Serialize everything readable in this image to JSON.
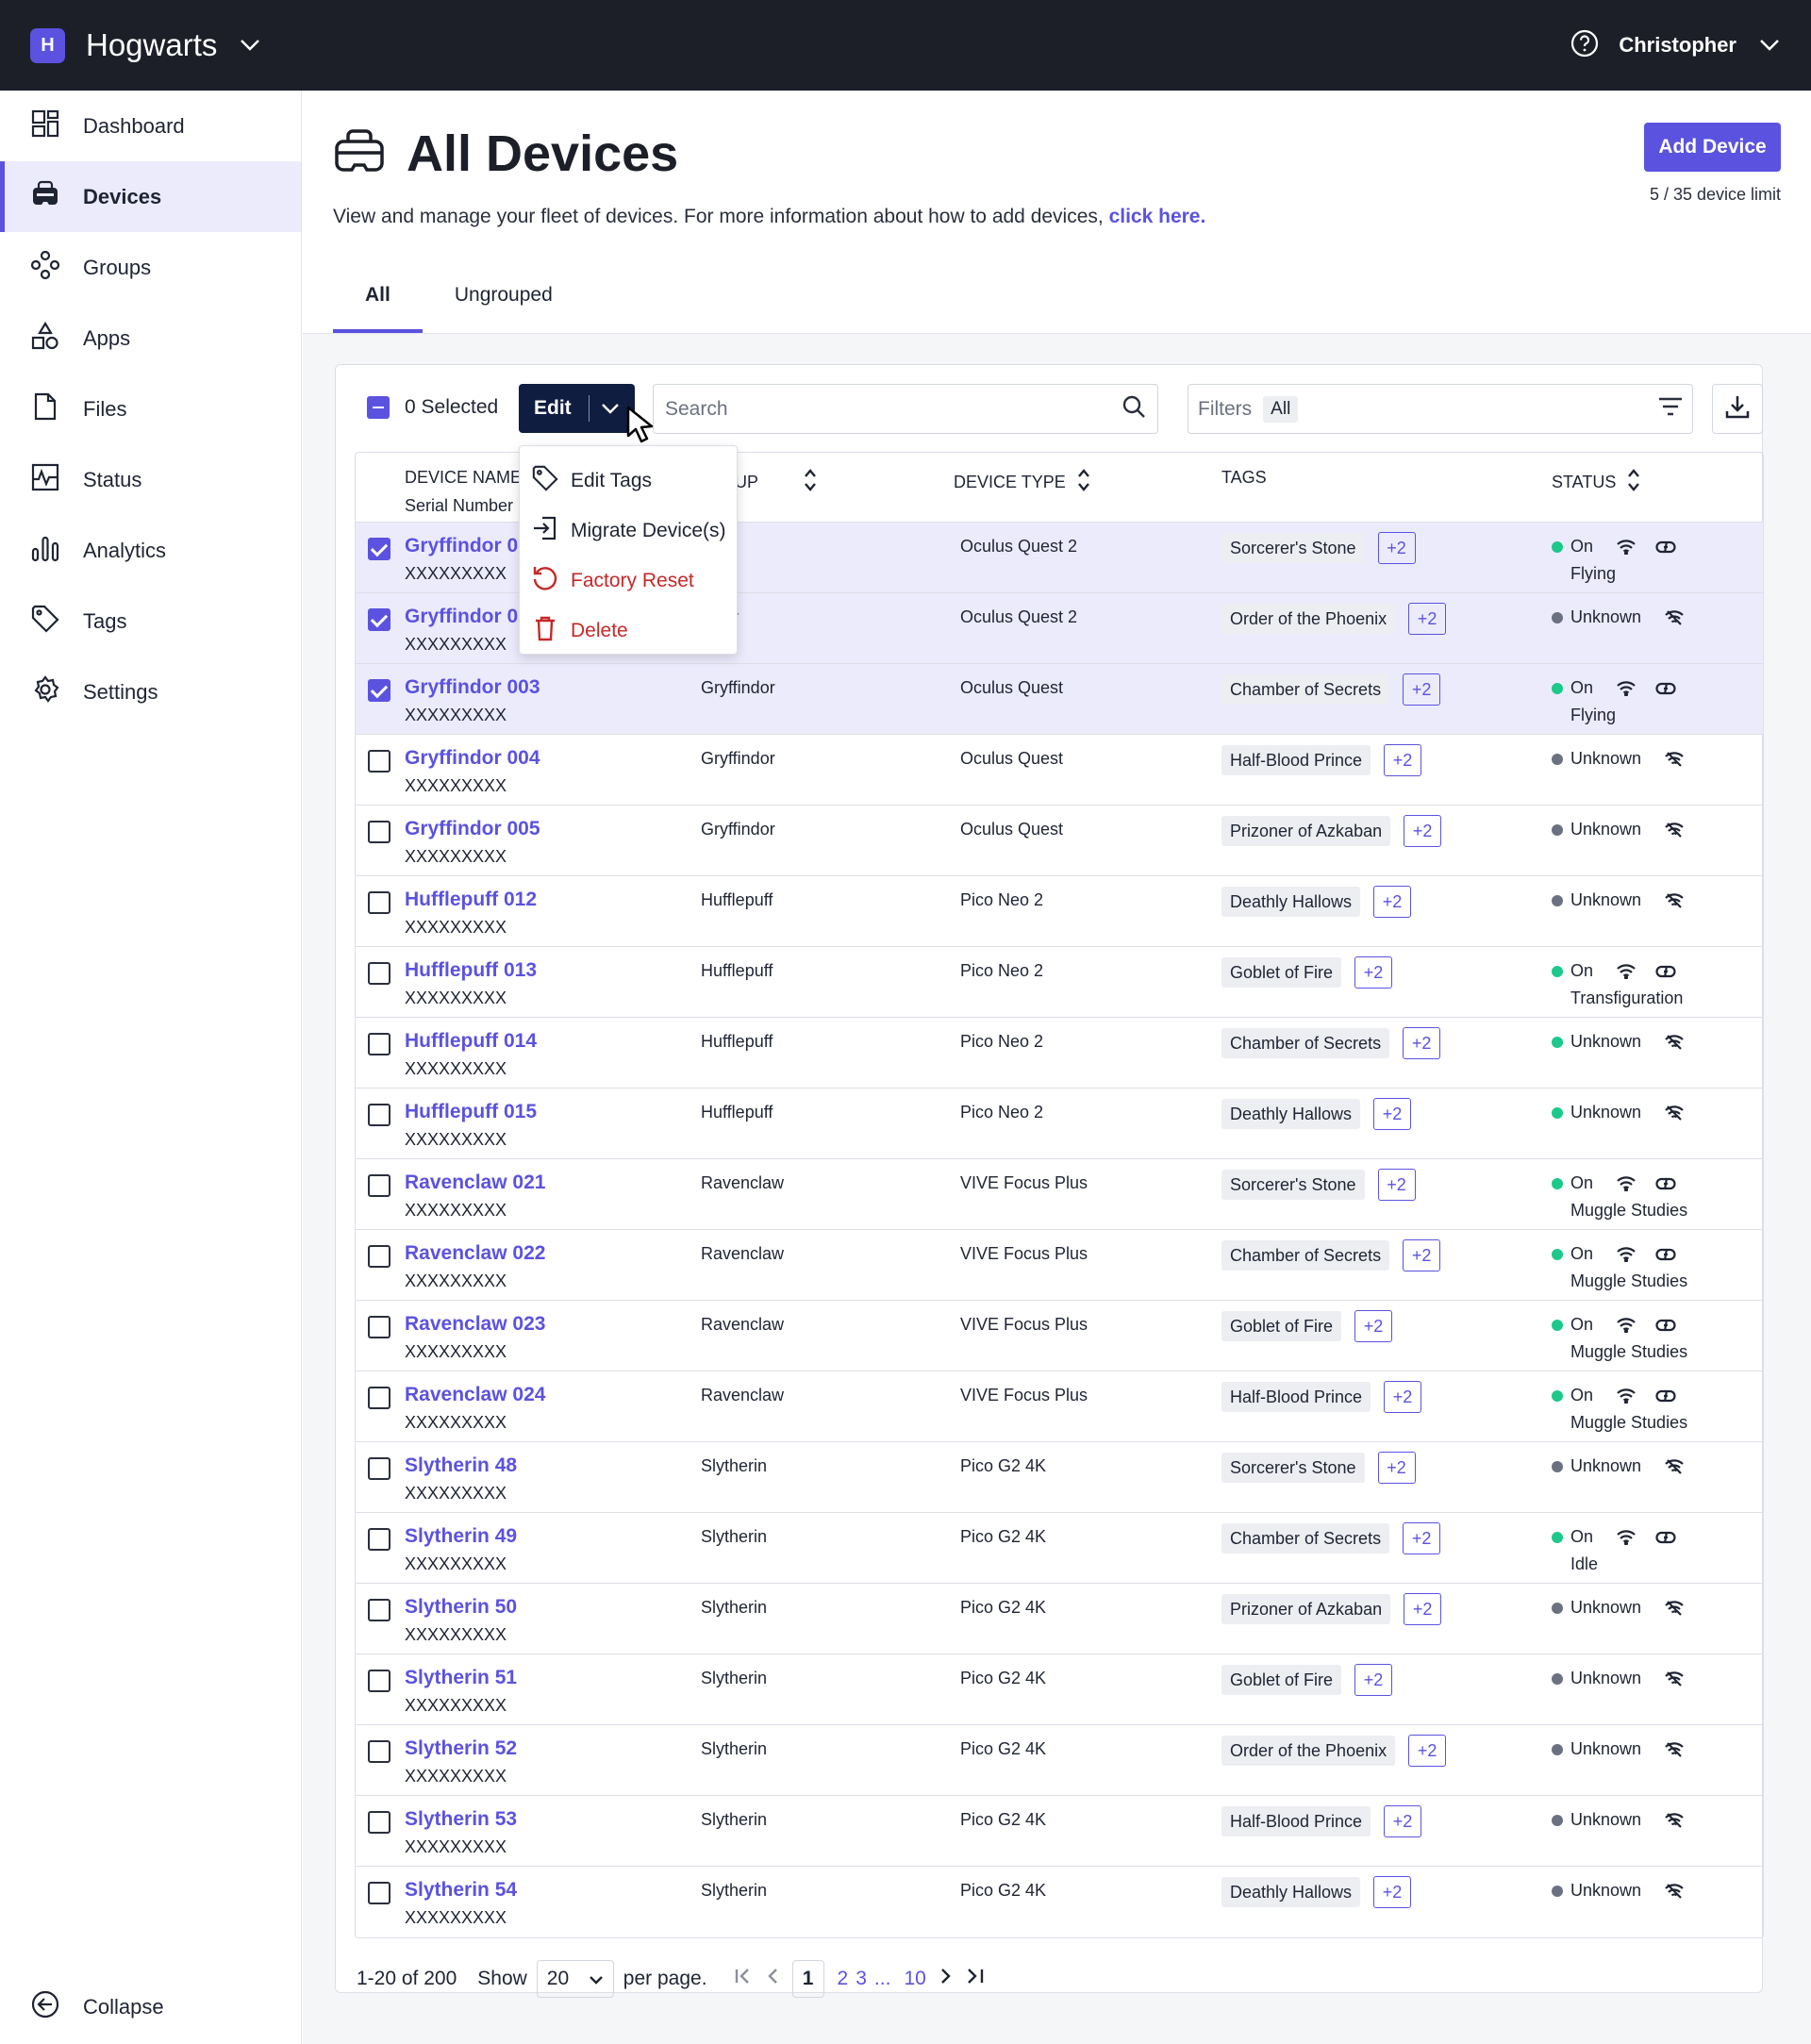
{
  "topbar": {
    "brand_letter": "H",
    "brand_name": "Hogwarts",
    "user_name": "Christopher"
  },
  "sidebar": {
    "items": [
      {
        "label": "Dashboard",
        "icon": "dashboard-icon"
      },
      {
        "label": "Devices",
        "icon": "headset-icon"
      },
      {
        "label": "Groups",
        "icon": "groups-icon"
      },
      {
        "label": "Apps",
        "icon": "apps-icon"
      },
      {
        "label": "Files",
        "icon": "file-icon"
      },
      {
        "label": "Status",
        "icon": "pulse-icon"
      },
      {
        "label": "Analytics",
        "icon": "bar-chart-icon"
      },
      {
        "label": "Tags",
        "icon": "tag-icon"
      },
      {
        "label": "Settings",
        "icon": "gear-icon"
      }
    ],
    "active": "Devices",
    "collapse_label": "Collapse"
  },
  "header": {
    "title": "All Devices",
    "description": "View and manage your fleet of devices. For more information about how to add devices, ",
    "link_text": "click here.",
    "add_button": "Add Device",
    "limit_text": "5 / 35 device limit",
    "tabs": [
      "All",
      "Ungrouped"
    ]
  },
  "toolbar": {
    "selected_text": "0 Selected",
    "edit_label": "Edit",
    "search_placeholder": "Search",
    "filters_label": "Filters",
    "filters_value": "All"
  },
  "edit_menu": {
    "items": [
      "Edit Tags",
      "Migrate Device(s)",
      "Factory Reset",
      "Delete"
    ]
  },
  "table": {
    "columns": {
      "device_name": "DEVICE NAME",
      "serial": "Serial Number",
      "group": "UP",
      "device_type": "DEVICE TYPE",
      "tags": "TAGS",
      "status": "STATUS"
    },
    "rows": [
      {
        "name": "Gryffindor 00",
        "serial": "XXXXXXXXX",
        "group": "p 1",
        "type": "Oculus Quest 2",
        "tag": "Sorcerer's Stone",
        "more": "+2",
        "status": "On",
        "activity": "Flying",
        "selected": true
      },
      {
        "name": "Gryffindor 00",
        "serial": "XXXXXXXXX",
        "group": "indor",
        "type": "Oculus Quest 2",
        "tag": "Order of the Phoenix",
        "more": "+2",
        "status": "Unknown",
        "activity": "",
        "selected": true
      },
      {
        "name": "Gryffindor 003",
        "serial": "XXXXXXXXX",
        "group": "Gryffindor",
        "type": "Oculus Quest",
        "tag": "Chamber of Secrets",
        "more": "+2",
        "status": "On",
        "activity": "Flying",
        "selected": true
      },
      {
        "name": "Gryffindor 004",
        "serial": "XXXXXXXXX",
        "group": "Gryffindor",
        "type": "Oculus Quest",
        "tag": "Half-Blood Prince",
        "more": "+2",
        "status": "Unknown",
        "activity": "",
        "selected": false
      },
      {
        "name": "Gryffindor 005",
        "serial": "XXXXXXXXX",
        "group": "Gryffindor",
        "type": "Oculus Quest",
        "tag": "Prizoner of Azkaban",
        "more": "+2",
        "status": "Unknown",
        "activity": "",
        "selected": false
      },
      {
        "name": "Hufflepuff 012",
        "serial": "XXXXXXXXX",
        "group": "Hufflepuff",
        "type": "Pico Neo 2",
        "tag": "Deathly Hallows",
        "more": "+2",
        "status": "Unknown",
        "activity": "",
        "selected": false
      },
      {
        "name": "Hufflepuff 013",
        "serial": "XXXXXXXXX",
        "group": "Hufflepuff",
        "type": "Pico Neo 2",
        "tag": "Goblet of Fire",
        "more": "+2",
        "status": "On",
        "activity": "Transfiguration",
        "selected": false
      },
      {
        "name": "Hufflepuff 014",
        "serial": "XXXXXXXXX",
        "group": "Hufflepuff",
        "type": "Pico Neo 2",
        "tag": "Chamber of Secrets",
        "more": "+2",
        "status": "Unknown",
        "activity": "",
        "selected": false,
        "green_unknown": true
      },
      {
        "name": "Hufflepuff 015",
        "serial": "XXXXXXXXX",
        "group": "Hufflepuff",
        "type": "Pico Neo 2",
        "tag": "Deathly Hallows",
        "more": "+2",
        "status": "Unknown",
        "activity": "",
        "selected": false,
        "green_unknown": true
      },
      {
        "name": "Ravenclaw 021",
        "serial": "XXXXXXXXX",
        "group": "Ravenclaw",
        "type": "VIVE Focus Plus",
        "tag": "Sorcerer's Stone",
        "more": "+2",
        "status": "On",
        "activity": "Muggle Studies",
        "selected": false
      },
      {
        "name": "Ravenclaw 022",
        "serial": "XXXXXXXXX",
        "group": "Ravenclaw",
        "type": "VIVE Focus Plus",
        "tag": "Chamber of Secrets",
        "more": "+2",
        "status": "On",
        "activity": "Muggle Studies",
        "selected": false
      },
      {
        "name": "Ravenclaw 023",
        "serial": "XXXXXXXXX",
        "group": "Ravenclaw",
        "type": "VIVE Focus Plus",
        "tag": "Goblet of Fire",
        "more": "+2",
        "status": "On",
        "activity": "Muggle Studies",
        "selected": false
      },
      {
        "name": "Ravenclaw 024",
        "serial": "XXXXXXXXX",
        "group": "Ravenclaw",
        "type": "VIVE Focus Plus",
        "tag": "Half-Blood Prince",
        "more": "+2",
        "status": "On",
        "activity": "Muggle Studies",
        "selected": false
      },
      {
        "name": "Slytherin 48",
        "serial": "XXXXXXXXX",
        "group": "Slytherin",
        "type": "Pico G2 4K",
        "tag": "Sorcerer's Stone",
        "more": "+2",
        "status": "Unknown",
        "activity": "",
        "selected": false
      },
      {
        "name": "Slytherin 49",
        "serial": "XXXXXXXXX",
        "group": "Slytherin",
        "type": "Pico G2 4K",
        "tag": "Chamber of Secrets",
        "more": "+2",
        "status": "On",
        "activity": "Idle",
        "selected": false
      },
      {
        "name": "Slytherin 50",
        "serial": "XXXXXXXXX",
        "group": "Slytherin",
        "type": "Pico G2 4K",
        "tag": "Prizoner of Azkaban",
        "more": "+2",
        "status": "Unknown",
        "activity": "",
        "selected": false
      },
      {
        "name": "Slytherin 51",
        "serial": "XXXXXXXXX",
        "group": "Slytherin",
        "type": "Pico G2 4K",
        "tag": "Goblet of Fire",
        "more": "+2",
        "status": "Unknown",
        "activity": "",
        "selected": false
      },
      {
        "name": "Slytherin 52",
        "serial": "XXXXXXXXX",
        "group": "Slytherin",
        "type": "Pico G2 4K",
        "tag": "Order of the Phoenix",
        "more": "+2",
        "status": "Unknown",
        "activity": "",
        "selected": false
      },
      {
        "name": "Slytherin 53",
        "serial": "XXXXXXXXX",
        "group": "Slytherin",
        "type": "Pico G2 4K",
        "tag": "Half-Blood Prince",
        "more": "+2",
        "status": "Unknown",
        "activity": "",
        "selected": false
      },
      {
        "name": "Slytherin 54",
        "serial": "XXXXXXXXX",
        "group": "Slytherin",
        "type": "Pico G2 4K",
        "tag": "Deathly Hallows",
        "more": "+2",
        "status": "Unknown",
        "activity": "",
        "selected": false
      }
    ]
  },
  "pagination": {
    "range": "1-20 of 200",
    "show_label": "Show",
    "per_page_value": "20",
    "per_page_label": "per page.",
    "current": "1",
    "pages": [
      "2",
      "3"
    ],
    "ellipsis": "...",
    "last": "10"
  },
  "colors": {
    "accent": "#5b52e0",
    "topbar": "#1c1f27",
    "on": "#1cc98a",
    "danger": "#c62828"
  }
}
